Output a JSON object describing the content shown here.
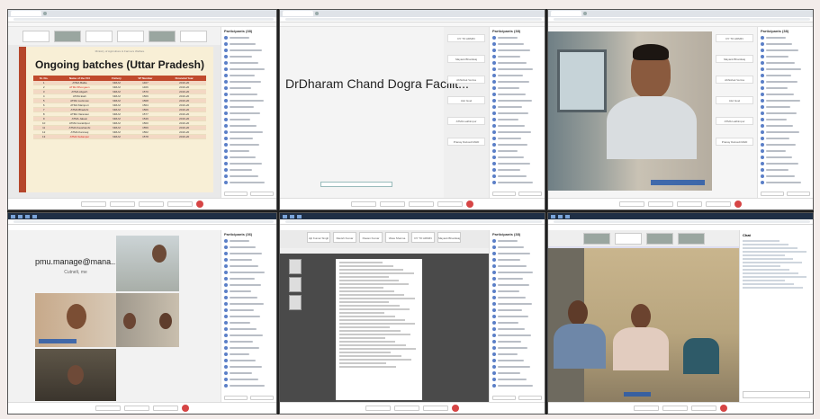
{
  "pane1": {
    "participants_title": "Participants (38)",
    "slide": {
      "subtitle": "Ministry of Agriculture & Farmers Welfare",
      "title": "Ongoing batches (Uttar Pradesh)",
      "headers": [
        "Sr. No.",
        "Name of the FCI",
        "Fishery",
        "VP Number",
        "Financial Year"
      ],
      "rows": [
        [
          "1",
          "ATMA Ballia",
          "NRLM",
          "1467",
          "2019-20"
        ],
        [
          "2",
          "ATMA Bhongaon",
          "NRLM",
          "1466",
          "2019-20"
        ],
        [
          "3",
          "ATMA Aligarh",
          "NRLM",
          "1570",
          "2019-20"
        ],
        [
          "4",
          "ATMA Etah",
          "NRLM",
          "1569",
          "2019-20"
        ],
        [
          "5",
          "ATMA Lucknow",
          "NRLM",
          "1568",
          "2019-20"
        ],
        [
          "6",
          "ATMA Mainpuri",
          "NRLM",
          "1564",
          "2019-20"
        ],
        [
          "7",
          "ATMA Bhadohi",
          "NRLM",
          "1566",
          "2019-20"
        ],
        [
          "8",
          "ATMA Varanasi",
          "NRLM",
          "1577",
          "2019-20"
        ],
        [
          "9",
          "ATMA Jalaun",
          "NRLM",
          "1549",
          "2019-20"
        ],
        [
          "10",
          "ATMA Gorakhpur",
          "NRLM",
          "1560",
          "2019-20"
        ],
        [
          "11",
          "ATMA Kaushambi",
          "NRLM",
          "1559",
          "2019-20"
        ],
        [
          "12",
          "ATMA Kannauj",
          "NRLM",
          "1562",
          "2019-20"
        ],
        [
          "13",
          "ATMA Sultanpur",
          "NRLM",
          "1578",
          "2019-20"
        ]
      ]
    }
  },
  "pane2": {
    "participants_title": "Participants (38)",
    "presenter_name": "DrDharam Chand Dogra Facilit...",
    "side_buttons": [
      "DY TO ADMIN",
      "Mayank Bhardwaj",
      "Abhishek Verma",
      "Atul Goel",
      "ATMA Lakhimpur",
      "Pranay Dwivedi MHD"
    ]
  },
  "pane3": {
    "participants_title": "Participants (38)",
    "side_buttons": [
      "DY TO ADMIN",
      "Mayank Bhardwaj",
      "Abhishek Verma",
      "Atul Goel",
      "ATMA Lakhimpur",
      "Pranay Dwivedi MHD"
    ]
  },
  "pane4": {
    "participants_title": "Participants (36)",
    "email_label": "pmu.manage@mana...",
    "sub_label": "Cutnelt, me"
  },
  "pane5": {
    "participants_title": "Participants (38)",
    "tabs": [
      "Ajit Kumar Singh",
      "Ravish Kumar Singh",
      "Pawan Kumar Yadav",
      "Vikas Sharma",
      "DY TO ADMIN",
      "Mayank Bhardwaj"
    ]
  },
  "pane6": {
    "chat_title": "Chat"
  },
  "colors": {
    "slide_accent": "#c04a2d",
    "slide_bg": "#f8efd6",
    "end_call": "#d64545",
    "highlight_text": "#d7261e"
  }
}
